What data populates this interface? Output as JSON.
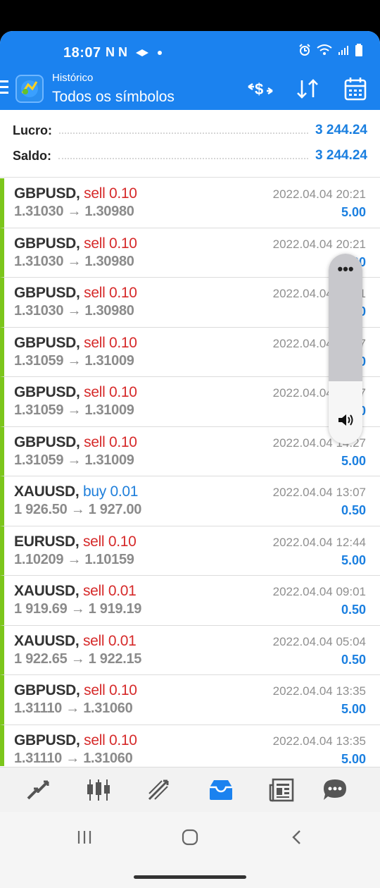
{
  "status_bar": {
    "time": "18:07",
    "left_icons": "N N",
    "icons": [
      "notification-icon",
      "alarm-icon",
      "wifi-icon",
      "signal-icon",
      "battery-icon"
    ]
  },
  "header": {
    "subtitle": "Histórico",
    "title": "Todos os símbolos",
    "actions": [
      "deposit-withdraw-icon",
      "sort-icon",
      "calendar-icon"
    ],
    "color": "#1b82ef"
  },
  "summary": {
    "profit_label": "Lucro:",
    "profit_value": "3 244.24",
    "balance_label": "Saldo:",
    "balance_value": "3 244.24"
  },
  "trades": [
    {
      "symbol": "GBPUSD,",
      "side": "sell",
      "side_text": "sell 0.10",
      "prices": "1.31030 → 1.30980",
      "time": "2022.04.04 20:21",
      "profit": "5.00"
    },
    {
      "symbol": "GBPUSD,",
      "side": "sell",
      "side_text": "sell 0.10",
      "prices": "1.31030 → 1.30980",
      "time": "2022.04.04 20:21",
      "profit": "5.00"
    },
    {
      "symbol": "GBPUSD,",
      "side": "sell",
      "side_text": "sell 0.10",
      "prices": "1.31030 → 1.30980",
      "time": "2022.04.04 20:21",
      "profit": "5.00"
    },
    {
      "symbol": "GBPUSD,",
      "side": "sell",
      "side_text": "sell 0.10",
      "prices": "1.31059 → 1.31009",
      "time": "2022.04.04 14:27",
      "profit": "5.00"
    },
    {
      "symbol": "GBPUSD,",
      "side": "sell",
      "side_text": "sell 0.10",
      "prices": "1.31059 → 1.31009",
      "time": "2022.04.04 14:27",
      "profit": "5.00"
    },
    {
      "symbol": "GBPUSD,",
      "side": "sell",
      "side_text": "sell 0.10",
      "prices": "1.31059 → 1.31009",
      "time": "2022.04.04 14:27",
      "profit": "5.00"
    },
    {
      "symbol": "XAUUSD,",
      "side": "buy",
      "side_text": "buy 0.01",
      "prices": "1 926.50 → 1 927.00",
      "time": "2022.04.04 13:07",
      "profit": "0.50"
    },
    {
      "symbol": "EURUSD,",
      "side": "sell",
      "side_text": "sell 0.10",
      "prices": "1.10209 → 1.10159",
      "time": "2022.04.04 12:44",
      "profit": "5.00"
    },
    {
      "symbol": "XAUUSD,",
      "side": "sell",
      "side_text": "sell 0.01",
      "prices": "1 919.69 → 1 919.19",
      "time": "2022.04.04 09:01",
      "profit": "0.50"
    },
    {
      "symbol": "XAUUSD,",
      "side": "sell",
      "side_text": "sell 0.01",
      "prices": "1 922.65 → 1 922.15",
      "time": "2022.04.04 05:04",
      "profit": "0.50"
    },
    {
      "symbol": "GBPUSD,",
      "side": "sell",
      "side_text": "sell 0.10",
      "prices": "1.31110 → 1.31060",
      "time": "2022.04.04 13:35",
      "profit": "5.00"
    },
    {
      "symbol": "GBPUSD,",
      "side": "sell",
      "side_text": "sell 0.10",
      "prices": "1.31110 → 1.31060",
      "time": "2022.04.04 13:35",
      "profit": "5.00"
    }
  ],
  "volume_overlay": {
    "more_label": "•••",
    "level": 0.67,
    "icons": [
      "more-icon",
      "speaker-icon"
    ]
  },
  "bottom_nav": {
    "items": [
      "quotes-icon",
      "chart-icon",
      "trade-icon",
      "history-icon",
      "news-icon",
      "chat-icon"
    ],
    "active": "history-icon",
    "active_color": "#1b82ef"
  },
  "system_nav": {
    "items": [
      "recent-apps-icon",
      "home-icon",
      "back-icon"
    ]
  }
}
